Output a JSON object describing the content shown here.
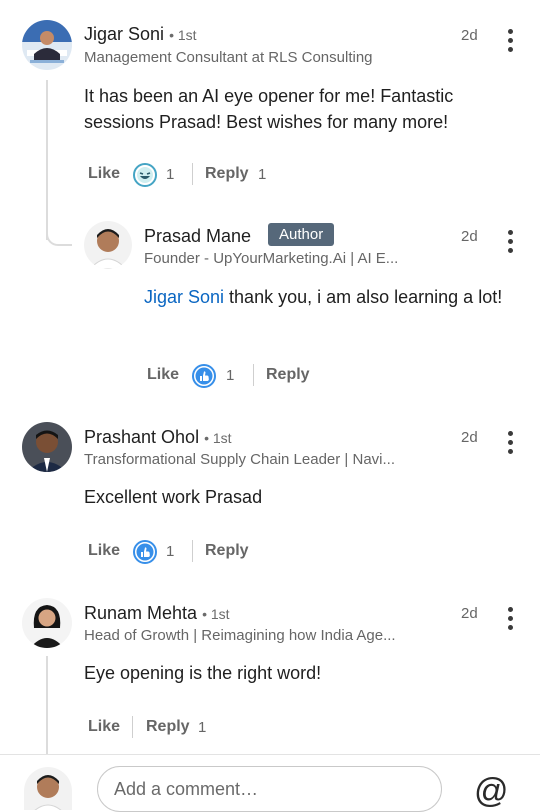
{
  "comments": [
    {
      "name": "Jigar Soni",
      "degree": "• 1st",
      "headline": "Management Consultant at RLS Consulting",
      "time": "2d",
      "text": "It has been an AI eye opener for me! Fantastic sessions Prasad! Best wishes for many more!",
      "like_label": "Like",
      "reaction_count": "1",
      "reply_label": "Reply",
      "reply_count": "1"
    },
    {
      "name": "Prasad Mane",
      "badge": "Author",
      "headline": "Founder - UpYourMarketing.Ai | AI E...",
      "time": "2d",
      "mention": "Jigar Soni",
      "text": " thank you, i am also learning a lot!",
      "like_label": "Like",
      "reaction_count": "1",
      "reply_label": "Reply"
    },
    {
      "name": "Prashant Ohol",
      "degree": "• 1st",
      "headline": "Transformational Supply Chain Leader | Navi...",
      "time": "2d",
      "text": "Excellent work Prasad",
      "like_label": "Like",
      "reaction_count": "1",
      "reply_label": "Reply"
    },
    {
      "name": "Runam Mehta",
      "degree": "• 1st",
      "headline": "Head of Growth | Reimagining how India Age...",
      "time": "2d",
      "text": "Eye opening is the right word!",
      "like_label": "Like",
      "reply_label": "Reply",
      "reply_count": "1"
    }
  ],
  "composer": {
    "placeholder": "Add a comment…",
    "mention_icon": "at-sign-icon"
  },
  "colors": {
    "link": "#0a66c2",
    "like_reaction": "#378fe9",
    "funny_reaction": "#44a4c4",
    "author_badge": "#56687a"
  }
}
